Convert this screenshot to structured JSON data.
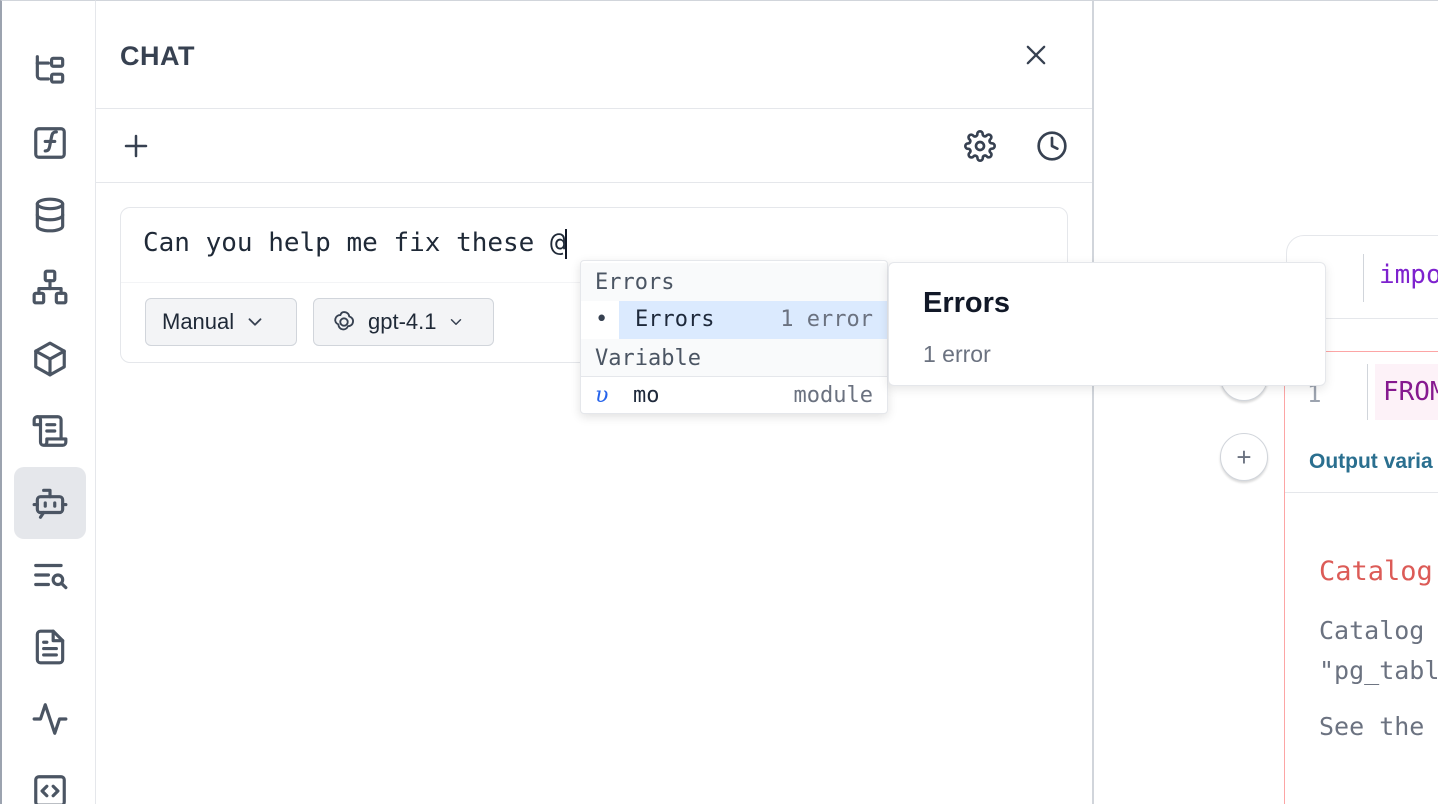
{
  "activity_bar": {
    "items": [
      {
        "icon": "file-tree-icon"
      },
      {
        "icon": "function-icon"
      },
      {
        "icon": "database-icon"
      },
      {
        "icon": "dependency-graph-icon"
      },
      {
        "icon": "package-icon"
      },
      {
        "icon": "scroll-icon"
      },
      {
        "icon": "bot-icon",
        "active": true
      },
      {
        "icon": "search-list-icon"
      },
      {
        "icon": "document-icon"
      },
      {
        "icon": "activity-icon"
      },
      {
        "icon": "code-icon"
      }
    ]
  },
  "chat": {
    "title": "CHAT",
    "input_text": "Can you help me fix these @",
    "mode_label": "Manual",
    "model_label": "gpt-4.1"
  },
  "autocomplete": {
    "groups": [
      {
        "header": "Errors",
        "items": [
          {
            "bullet": "•",
            "label": "Errors",
            "detail": "1 error",
            "selected": true
          }
        ]
      },
      {
        "header": "Variable",
        "items": [
          {
            "icon": "υ",
            "label": "mo",
            "detail": "module"
          }
        ]
      }
    ],
    "info": {
      "title": "Errors",
      "subtitle": "1 error"
    }
  },
  "notebook": {
    "cell1_code": "impo",
    "cell2_line": "1",
    "cell2_code": "FROM",
    "output_var_label": "Output varia",
    "error_title": "Catalog",
    "error_lines": [
      "Catalog",
      "\"pg_tabl",
      "See the"
    ],
    "add_cell_symbol": "+"
  }
}
